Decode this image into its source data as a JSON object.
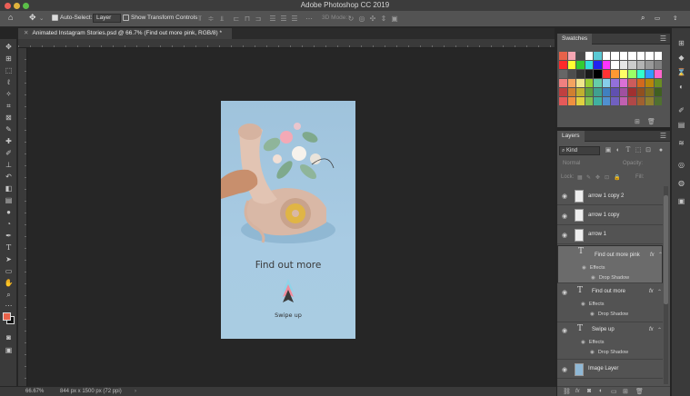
{
  "app": {
    "title": "Adobe Photoshop CC 2019"
  },
  "options_bar": {
    "auto_select_label": "Auto-Select:",
    "auto_select_target": "Layer",
    "transform_controls_label": "Show Transform Controls",
    "mode_3d": "3D Mode:"
  },
  "document": {
    "tab_title": "Animated Instagram Stories.psd @ 66.7% (Find out more pink, RGB/8) *",
    "headline": "Find out more",
    "cta": "Swipe up"
  },
  "status_bar": {
    "zoom": "66.67%",
    "doc_info": "844 px x 1500 px (72 ppi)"
  },
  "swatches_panel": {
    "title": "Swatches",
    "colors": [
      "#e8624a",
      "#f6a6b3",
      "#4a4a4a",
      "#ffffff",
      "#5ac9d4",
      "#ffffff",
      "#ffffff",
      "#ffffff",
      "#ffffff",
      "#ffffff",
      "#ffffff",
      "#ffffff",
      "#ff2a2a",
      "#ffff33",
      "#33cc33",
      "#33dddd",
      "#2222ee",
      "#ff33ff",
      "#ffffff",
      "#e6e6e6",
      "#cccccc",
      "#b3b3b3",
      "#999999",
      "#808080",
      "#666666",
      "#4d4d4d",
      "#333333",
      "#1a1a1a",
      "#000000",
      "#ff3333",
      "#ff9933",
      "#ffff66",
      "#99ff66",
      "#33ffcc",
      "#3399ff",
      "#ff66cc",
      "#f08080",
      "#f4a460",
      "#f0e68c",
      "#9acd32",
      "#66cdaa",
      "#87ceeb",
      "#9370db",
      "#da70d6",
      "#cd5c5c",
      "#d2691e",
      "#b8860b",
      "#6b8e23",
      "#c04040",
      "#d08030",
      "#c0b030",
      "#60a040",
      "#40a090",
      "#4080c0",
      "#6050b0",
      "#a050a0",
      "#a03030",
      "#905020",
      "#807020",
      "#406020",
      "#e65a5a",
      "#f09040",
      "#e0d040",
      "#80c050",
      "#40b0a0",
      "#5090d0",
      "#7060c0",
      "#c060b0",
      "#b04848",
      "#a06030",
      "#908030",
      "#507030"
    ]
  },
  "layers_panel": {
    "title": "Layers",
    "kind_label": "Kind",
    "blend_mode": "Normal",
    "opacity_label": "Opacity:",
    "lock_label": "Lock:",
    "fill_label": "Fill:",
    "effects_label": "Effects",
    "drop_shadow_label": "Drop Shadow",
    "fx_label": "fx",
    "layers": [
      {
        "name": "arrow 1 copy 2"
      },
      {
        "name": "arrow 1 copy"
      },
      {
        "name": "arrow 1"
      },
      {
        "name": "Find out more pink"
      },
      {
        "name": "Find out more"
      },
      {
        "name": "Swipe up"
      },
      {
        "name": "Image Layer"
      }
    ]
  }
}
